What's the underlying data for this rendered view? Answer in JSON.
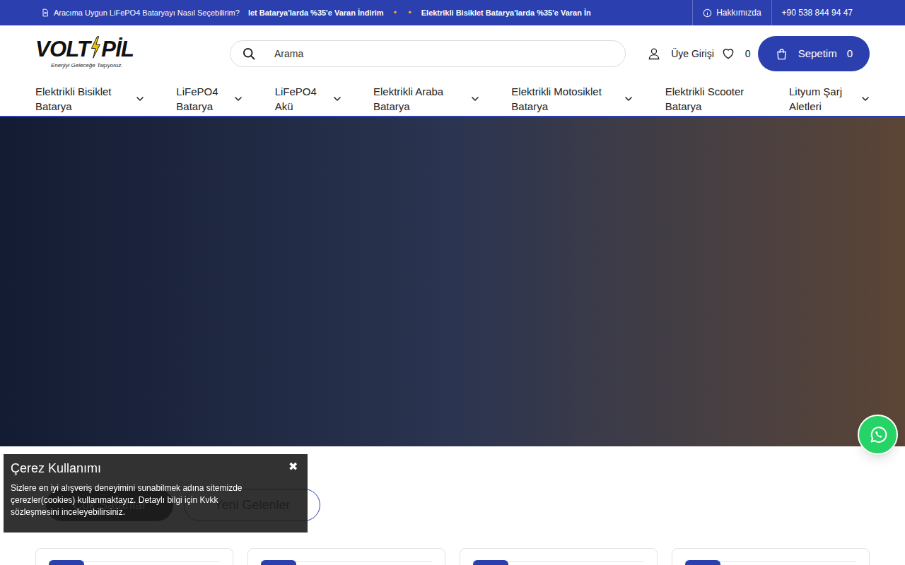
{
  "announcement_bar": {
    "ticker": [
      {
        "kind": "article",
        "text": "Aracıma Uygun LiFePO4 Bataryayı Nasıl Seçebilirim?"
      },
      {
        "kind": "promo",
        "text": "let Batarya'larda %35'e Varan İndirim"
      },
      {
        "kind": "dot",
        "text": "•"
      },
      {
        "kind": "dot",
        "text": "•"
      },
      {
        "kind": "promo",
        "text": "Elektrikli Bisiklet Batarya'larda %35'e Varan İn"
      }
    ],
    "links": [
      {
        "kind": "about",
        "label": "Hakkımızda"
      },
      {
        "kind": "phone",
        "label": "+90 538 844 94 47"
      }
    ]
  },
  "logo": {
    "left": "VOLT",
    "right": "PİL",
    "tagline": "Enerjiyi Geleceğe Taşıyoruz."
  },
  "search": {
    "placeholder": "Arama"
  },
  "account": {
    "label": "Üye Girişi"
  },
  "favorites": {
    "count": "0"
  },
  "cart": {
    "label": "Sepetim",
    "count": "0"
  },
  "nav": [
    {
      "label": "Elektrikli Bisiklet Batarya",
      "has_dropdown": true
    },
    {
      "label": "LiFePO4 Batarya",
      "has_dropdown": true
    },
    {
      "label": "LiFePO4 Akü",
      "has_dropdown": true
    },
    {
      "label": "Elektrikli Araba Batarya",
      "has_dropdown": true
    },
    {
      "label": "Elektrikli Motosiklet Batarya",
      "has_dropdown": true
    },
    {
      "label": "Elektrikli Scooter Batarya",
      "has_dropdown": false
    },
    {
      "label": "Lityum Şarj Aletleri",
      "has_dropdown": true
    }
  ],
  "product_tabs": [
    {
      "label": "Çok Satanlar",
      "selected": true
    },
    {
      "label": "Yeni Gelenler",
      "selected": false
    }
  ],
  "products": [
    {
      "badge": true
    },
    {
      "badge": true
    },
    {
      "badge": true
    },
    {
      "badge": true
    }
  ],
  "cookie_banner": {
    "title": "Çerez Kullanımı",
    "close": "✖",
    "text": "Sizlere en iyi alışveriş deneyimini sunabilmek adına sitemizde çerezler(cookies) kullanmaktayız. Detaylı bilgi için Kvkk sözleşmesini inceleyebilirsiniz."
  }
}
